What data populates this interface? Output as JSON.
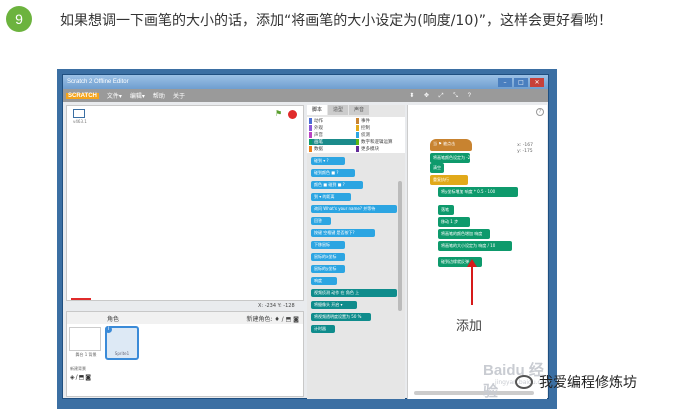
{
  "step": {
    "number": "9",
    "text": "如果想调一下画笔的大小的话，添加“将画笔的大小设定为(响度/10)”，这样会更好看哟！"
  },
  "editor": {
    "window_title": "Scratch 2 Offline Editor",
    "window_buttons": [
      "–",
      "□",
      "✕"
    ],
    "menu": {
      "logo": "SCRATCH",
      "items": [
        "文件▾",
        "编辑▾",
        "帮助",
        "关于"
      ],
      "toolbar_icons": "⬍ ✥ ⤢ ⤡ ?"
    },
    "stage": {
      "version": "v463.1",
      "coords": "X: -234  Y: -128"
    },
    "sprites": {
      "header": "角色",
      "new_sprite": "新建角色: ♦ / ⬒ ◙",
      "backdrop_label": "舞台\n1 背景",
      "sprite_name": "Sprite1",
      "new_backdrop": "新建背景",
      "new_backdrop_icons": "◈/⬒◙"
    },
    "palette": {
      "tabs": [
        "脚本",
        "造型",
        "声音"
      ],
      "categories": [
        {
          "label": "动作",
          "color": "#4a6cd4"
        },
        {
          "label": "事件",
          "color": "#c88330"
        },
        {
          "label": "外观",
          "color": "#8a55d7"
        },
        {
          "label": "控制",
          "color": "#e1a91a"
        },
        {
          "label": "声音",
          "color": "#bb42c3"
        },
        {
          "label": "侦测",
          "color": "#2ca5e2"
        },
        {
          "label": "画笔",
          "color": "#0e9a6c"
        },
        {
          "label": "数字和逻辑运算",
          "color": "#5cb712"
        },
        {
          "label": "数据",
          "color": "#ee7d16"
        },
        {
          "label": "更多模块",
          "color": "#632d99"
        }
      ],
      "blocks": [
        "碰到 ▾ ?",
        "碰到颜色 ■ ?",
        "颜色 ■ 碰到 ■ ?",
        "到 ▾ 的距离",
        "询问 What's your name? 并等待",
        "回答",
        "按键 空格键 是否按下?",
        "下移鼠标",
        "鼠标的x坐标",
        "鼠标的y坐标",
        "响度",
        "视频侦测 动作 在 角色 上",
        "将摄像头 开启 ▾",
        "将视频透明度设置为 50 %",
        "计时器"
      ]
    },
    "scripts": {
      "coords": "x: -167\ny: -175",
      "hat": "当 ⚑ 被点击",
      "blocks": [
        "将画笔颜色设定为 -240",
        "清空",
        "重复执行",
        "将y坐标增加 响度 * 0.5 - 100",
        "落笔",
        "移动 1 步",
        "将画笔的颜色增加 响度",
        "将画笔的大小设定为 响度 / 10",
        "碰到边缘就反弹"
      ]
    },
    "annotation": "添加",
    "watermark": "Baidu 经验",
    "watermark_sub": "jingyan.baidu.com"
  },
  "wechat_watermark": "我爱编程修炼坊"
}
